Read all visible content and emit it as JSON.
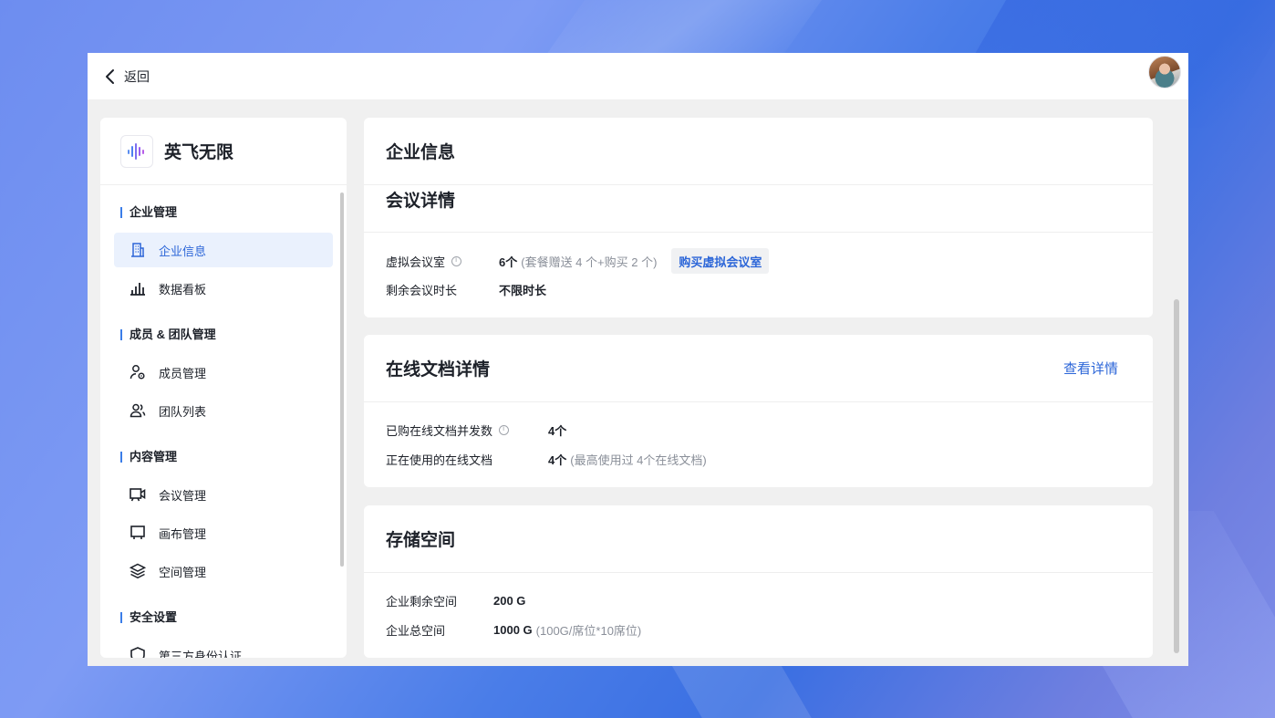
{
  "topbar": {
    "back_label": "返回"
  },
  "sidebar": {
    "brand_name": "英飞无限",
    "sections": [
      {
        "title": "企业管理",
        "items": [
          {
            "label": "企业信息",
            "icon": "building-icon",
            "active": true
          },
          {
            "label": "数据看板",
            "icon": "bar-chart-icon"
          }
        ]
      },
      {
        "title": "成员 & 团队管理",
        "items": [
          {
            "label": "成员管理",
            "icon": "user-settings-icon"
          },
          {
            "label": "团队列表",
            "icon": "team-icon"
          }
        ]
      },
      {
        "title": "内容管理",
        "items": [
          {
            "label": "会议管理",
            "icon": "video-camera-icon"
          },
          {
            "label": "画布管理",
            "icon": "canvas-icon"
          },
          {
            "label": "空间管理",
            "icon": "layers-icon"
          }
        ]
      },
      {
        "title": "安全设置",
        "items": [
          {
            "label": "第三方身份认证",
            "icon": "shield-icon"
          }
        ]
      }
    ]
  },
  "main": {
    "enterprise_card": {
      "title": "企业信息",
      "subtitle": "会议详情",
      "virtual_room_label": "虚拟会议室",
      "virtual_room_value": "6个",
      "virtual_room_note": "(套餐赠送 4 个+购买 2 个)",
      "buy_button": "购买虚拟会议室",
      "remaining_time_label": "剩余会议时长",
      "remaining_time_value": "不限时长"
    },
    "docs_card": {
      "title": "在线文档详情",
      "link": "查看详情",
      "concurrency_label": "已购在线文档并发数",
      "concurrency_value": "4个",
      "in_use_label": "正在使用的在线文档",
      "in_use_value": "4个",
      "in_use_note": "(最高使用过 4个在线文档)"
    },
    "storage_card": {
      "title": "存储空间",
      "remaining_label": "企业剩余空间",
      "remaining_value": "200 G",
      "total_label": "企业总空间",
      "total_value": "1000 G",
      "total_note": "(100G/席位*10席位)"
    }
  },
  "colors": {
    "accent": "#2c66d8",
    "active_bg": "#eaf1fd",
    "section_bar": "#3b7de8"
  }
}
